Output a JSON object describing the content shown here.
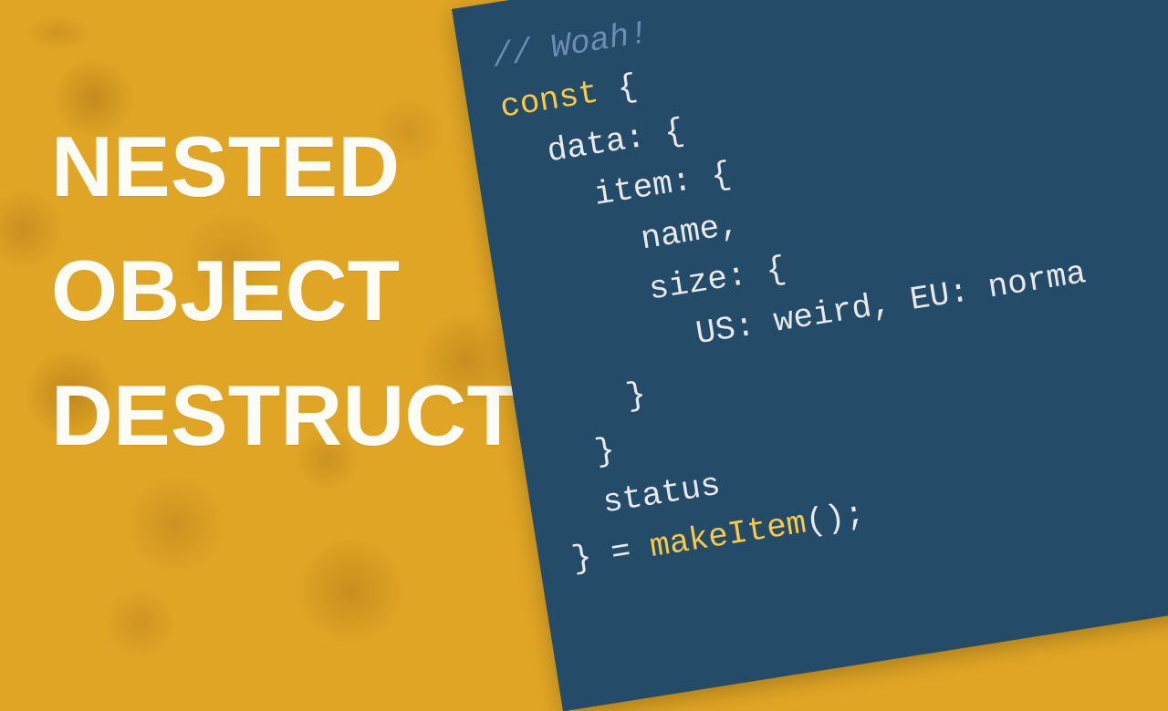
{
  "title": {
    "line1": "NESTED",
    "line2": "OBJECT",
    "line3": "DESTRUCTURING"
  },
  "code": {
    "commentSlash": "// ",
    "commentText": "Woah!",
    "keywordConst": "const",
    "braceOpen": " {",
    "l_data": "  data: {",
    "l_item": "    item: {",
    "l_name": "      name,",
    "l_size": "      size: {",
    "l_usEu": "        US: weird, EU: norma",
    "l_close1": "    }",
    "l_close2": "  }",
    "l_status": "  status",
    "closeBrace": "} = ",
    "fnName": "makeItem",
    "fnCall": "();"
  },
  "colors": {
    "bg": "#e0a524",
    "card": "#244b67",
    "text": "#fdfcf5",
    "keyword": "#f7c948",
    "comment": "#6c8bb6"
  }
}
